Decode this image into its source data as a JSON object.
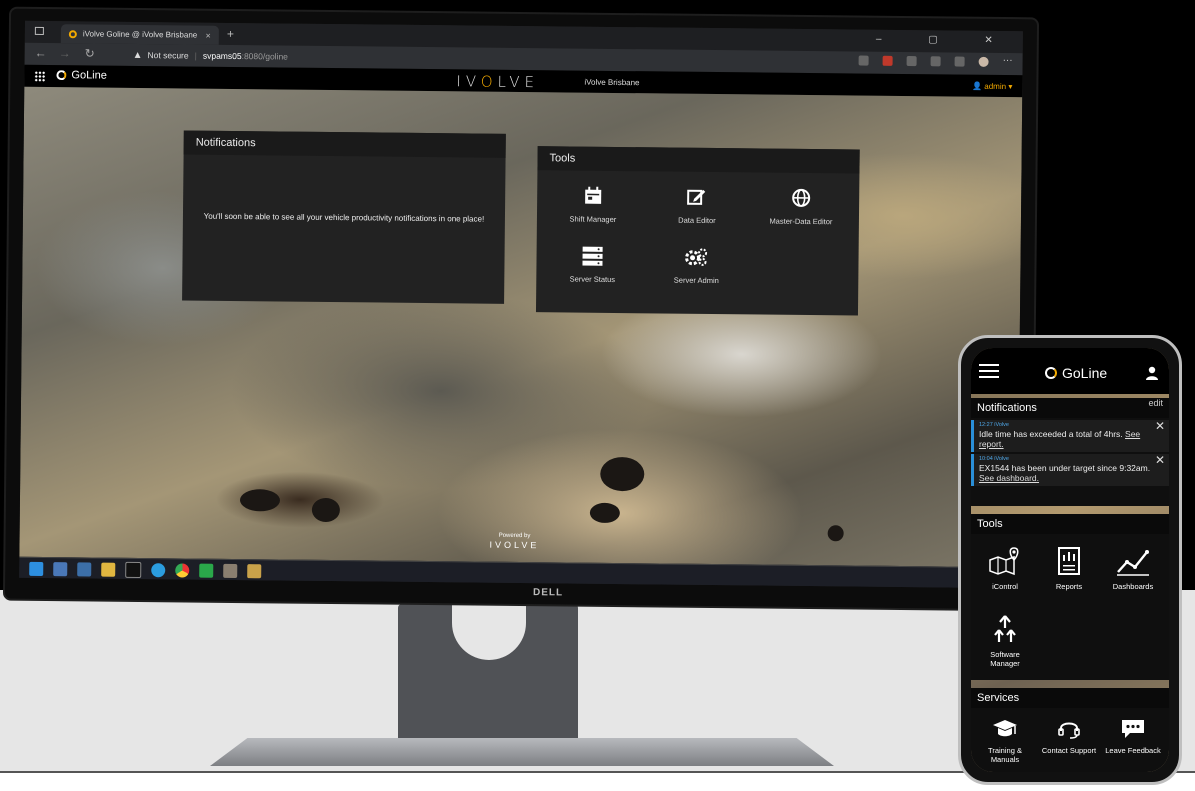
{
  "browser": {
    "tab_title": "iVolve Goline @ iVolve Brisbane",
    "tab_close": "×",
    "new_tab": "+",
    "security": "Not secure",
    "url_host": "svpams05",
    "url_path": ":8080/goline",
    "window_controls": "–  ▢  ✕",
    "more": "···"
  },
  "app": {
    "name": "GoLine",
    "brand_pre": "IV",
    "brand_o": "O",
    "brand_post": "LVE",
    "site": "iVolve Brisbane",
    "user": "admin"
  },
  "notifications": {
    "title": "Notifications",
    "message": "You'll soon be able to see all your vehicle productivity notifications in one place!"
  },
  "tools": {
    "title": "Tools",
    "items": [
      {
        "label": "Shift Manager",
        "icon": "calendar-icon"
      },
      {
        "label": "Data Editor",
        "icon": "edit-icon"
      },
      {
        "label": "Master-Data Editor",
        "icon": "globe-icon"
      },
      {
        "label": "Server Status",
        "icon": "server-icon"
      },
      {
        "label": "Server Admin",
        "icon": "gears-icon"
      }
    ]
  },
  "footer": {
    "powered_by": "Powered by",
    "brand": "IVOLVE"
  },
  "monitor_brand": "DELL",
  "phone": {
    "app_name": "GoLine",
    "notifications": {
      "title": "Notifications",
      "edit": "edit",
      "items": [
        {
          "time": "12:27 iVolve",
          "text": "Idle time has exceeded a total of 4hrs.",
          "link": "See report."
        },
        {
          "time": "10:04 iVolve",
          "text": "EX1544 has been under target since 9:32am.",
          "link": "See dashboard."
        }
      ]
    },
    "tools": {
      "title": "Tools",
      "items": [
        {
          "label": "iControl",
          "icon": "map-pin-icon"
        },
        {
          "label": "Reports",
          "icon": "report-icon"
        },
        {
          "label": "Dashboards",
          "icon": "trend-line-icon"
        },
        {
          "label": "Software Manager",
          "icon": "upload-arrows-icon"
        }
      ]
    },
    "services": {
      "title": "Services",
      "items": [
        {
          "label": "Training & Manuals",
          "icon": "graduation-cap-icon"
        },
        {
          "label": "Contact Support",
          "icon": "headset-icon"
        },
        {
          "label": "Leave Feedback",
          "icon": "chat-bubble-icon"
        }
      ]
    }
  }
}
